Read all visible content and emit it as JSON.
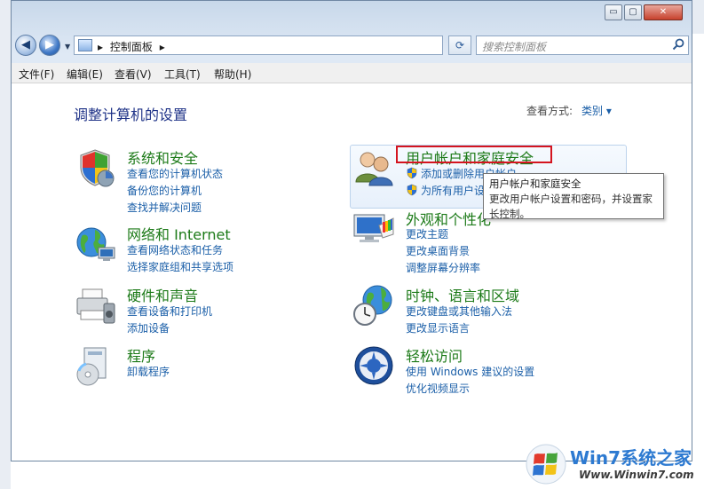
{
  "window": {
    "minimize": "▭",
    "maximize": "▢",
    "close": "✕"
  },
  "nav": {
    "back": "◀",
    "forward": "▶",
    "dropdown": "▼"
  },
  "address": {
    "path": "控制面板",
    "separator_glyph": "▸",
    "dropdown": "▼"
  },
  "refresh_glyph": "⟳",
  "search": {
    "placeholder": "搜索控制面板"
  },
  "menu": [
    "文件(F)",
    "编辑(E)",
    "查看(V)",
    "工具(T)",
    "帮助(H)"
  ],
  "page": {
    "title": "调整计算机的设置",
    "view_by_label": "查看方式:",
    "view_by_value": "类别 ▾"
  },
  "categories": [
    {
      "title": "系统和安全",
      "links": [
        "查看您的计算机状态",
        "备份您的计算机",
        "查找并解决问题"
      ]
    },
    {
      "title": "网络和 Internet",
      "links": [
        "查看网络状态和任务",
        "选择家庭组和共享选项"
      ]
    },
    {
      "title": "硬件和声音",
      "links": [
        "查看设备和打印机",
        "添加设备"
      ]
    },
    {
      "title": "程序",
      "links": [
        "卸载程序"
      ]
    },
    {
      "title": "用户帐户和家庭安全",
      "links": [
        "添加或删除用户帐户",
        "为所有用户设"
      ]
    },
    {
      "title": "外观和个性化",
      "links": [
        "更改主题",
        "更改桌面背景",
        "调整屏幕分辨率"
      ]
    },
    {
      "title": "时钟、语言和区域",
      "links": [
        "更改键盘或其他输入法",
        "更改显示语言"
      ]
    },
    {
      "title": "轻松访问",
      "links": [
        "使用 Windows 建议的设置",
        "优化视频显示"
      ]
    }
  ],
  "tooltip": {
    "title": "用户帐户和家庭安全",
    "line1": "更改用户帐户设置和密码，并设置家",
    "line2": "长控制。"
  },
  "watermark": {
    "brand": "Win7系统之家",
    "url": "Www.Winwin7.com"
  },
  "colors": {
    "link": "#1b5fa8",
    "category_title": "#1c7a18",
    "page_title": "#1e3287",
    "highlight_border": "#d4141f"
  }
}
